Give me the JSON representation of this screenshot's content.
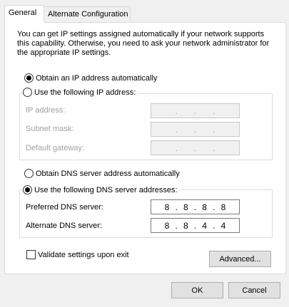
{
  "tabs": [
    {
      "label": "General"
    },
    {
      "label": "Alternate Configuration"
    }
  ],
  "intro_text": "You can get IP settings assigned automatically if your network supports this capability. Otherwise, you need to ask your network administrator for the appropriate IP settings.",
  "ip": {
    "auto_label": "Obtain an IP address automatically",
    "manual_label": "Use the following IP address:",
    "auto_selected": true,
    "fields": [
      {
        "label": "IP address:",
        "value": [
          ".",
          ".",
          "."
        ]
      },
      {
        "label": "Subnet mask:",
        "value": [
          ".",
          ".",
          "."
        ]
      },
      {
        "label": "Default gateway:",
        "value": [
          ".",
          ".",
          "."
        ]
      }
    ]
  },
  "dns": {
    "auto_label": "Obtain DNS server address automatically",
    "manual_label": "Use the following DNS server addresses:",
    "manual_selected": true,
    "preferred_label": "Preferred DNS server:",
    "preferred_octets": [
      "8",
      "8",
      "8",
      "8"
    ],
    "alternate_label": "Alternate DNS server:",
    "alternate_octets": [
      "8",
      "8",
      "4",
      "4"
    ]
  },
  "validate_label": "Validate settings upon exit",
  "validate_checked": false,
  "advanced_label": "Advanced...",
  "ok_label": "OK",
  "cancel_label": "Cancel"
}
